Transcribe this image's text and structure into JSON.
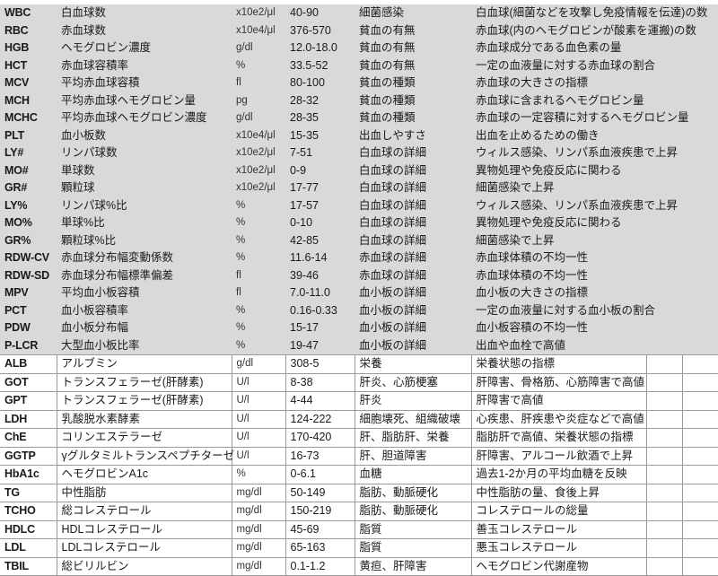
{
  "table": {
    "columns": [
      "code",
      "name",
      "unit",
      "range",
      "category",
      "description",
      "extra1",
      "extra2"
    ],
    "bands": {
      "hematology_bg": "#d9d9d9",
      "biochemistry_bg": "#ffffff",
      "grid_line": "#9a9a9a"
    },
    "rows": [
      {
        "code": "WBC",
        "name": "白血球数",
        "unit": "x10e2/μl",
        "range": "40-90",
        "category": "細菌感染",
        "description": "白血球(細菌などを攻撃し免疫情報を伝達)の数",
        "band": "grey"
      },
      {
        "code": "RBC",
        "name": "赤血球数",
        "unit": "x10e4/μl",
        "range": "376-570",
        "category": "貧血の有無",
        "description": "赤血球(内のヘモグロビンが酸素を運搬)の数",
        "band": "grey"
      },
      {
        "code": "HGB",
        "name": "ヘモグロビン濃度",
        "unit": "g/dl",
        "range": "12.0-18.0",
        "category": "貧血の有無",
        "description": "赤血球成分である血色素の量",
        "band": "grey"
      },
      {
        "code": "HCT",
        "name": "赤血球容積率",
        "unit": "%",
        "range": "33.5-52",
        "category": "貧血の有無",
        "description": "一定の血液量に対する赤血球の割合",
        "band": "grey"
      },
      {
        "code": "MCV",
        "name": "平均赤血球容積",
        "unit": "fl",
        "range": "80-100",
        "category": "貧血の種類",
        "description": "赤血球の大きさの指標",
        "band": "grey"
      },
      {
        "code": "MCH",
        "name": "平均赤血球ヘモグロビン量",
        "unit": "pg",
        "range": "28-32",
        "category": "貧血の種類",
        "description": "赤血球に含まれるヘモグロビン量",
        "band": "grey"
      },
      {
        "code": "MCHC",
        "name": "平均赤血球ヘモグロビン濃度",
        "unit": "g/dl",
        "range": "28-35",
        "category": "貧血の種類",
        "description": "赤血球の一定容積に対するヘモグロビン量",
        "band": "grey"
      },
      {
        "code": "PLT",
        "name": "血小板数",
        "unit": "x10e4/μl",
        "range": "15-35",
        "category": "出血しやすさ",
        "description": "出血を止めるための働き",
        "band": "grey"
      },
      {
        "code": "LY#",
        "name": "リンパ球数",
        "unit": "x10e2/μl",
        "range": "7-51",
        "category": "白血球の詳細",
        "description": "ウィルス感染、リンパ系血液疾患で上昇",
        "band": "grey"
      },
      {
        "code": "MO#",
        "name": "単球数",
        "unit": "x10e2/μl",
        "range": "0-9",
        "category": "白血球の詳細",
        "description": "異物処理や免疫反応に関わる",
        "band": "grey"
      },
      {
        "code": "GR#",
        "name": "顆粒球",
        "unit": "x10e2/μl",
        "range": "17-77",
        "category": "白血球の詳細",
        "description": "細菌感染で上昇",
        "band": "grey"
      },
      {
        "code": "LY%",
        "name": "リンパ球%比",
        "unit": "%",
        "range": "17-57",
        "category": "白血球の詳細",
        "description": "ウィルス感染、リンパ系血液疾患で上昇",
        "band": "grey"
      },
      {
        "code": "MO%",
        "name": "単球%比",
        "unit": "%",
        "range": "0-10",
        "category": "白血球の詳細",
        "description": "異物処理や免疫反応に関わる",
        "band": "grey"
      },
      {
        "code": "GR%",
        "name": "顆粒球%比",
        "unit": "%",
        "range": "42-85",
        "category": "白血球の詳細",
        "description": "細菌感染で上昇",
        "band": "grey"
      },
      {
        "code": "RDW-CV",
        "name": "赤血球分布幅変動係数",
        "unit": "%",
        "range": "11.6-14",
        "category": "赤血球の詳細",
        "description": "赤血球体積の不均一性",
        "band": "grey"
      },
      {
        "code": "RDW-SD",
        "name": "赤血球分布幅標準偏差",
        "unit": "fl",
        "range": "39-46",
        "category": "赤血球の詳細",
        "description": "赤血球体積の不均一性",
        "band": "grey"
      },
      {
        "code": "MPV",
        "name": "平均血小板容積",
        "unit": "fl",
        "range": "7.0-11.0",
        "category": "血小板の詳細",
        "description": "血小板の大きさの指標",
        "band": "grey"
      },
      {
        "code": "PCT",
        "name": "血小板容積率",
        "unit": "%",
        "range": "0.16-0.33",
        "category": "血小板の詳細",
        "description": "一定の血液量に対する血小板の割合",
        "band": "grey"
      },
      {
        "code": "PDW",
        "name": "血小板分布幅",
        "unit": "%",
        "range": "15-17",
        "category": "血小板の詳細",
        "description": "血小板容積の不均一性",
        "band": "grey"
      },
      {
        "code": "P-LCR",
        "name": "大型血小板比率",
        "unit": "%",
        "range": "19-47",
        "category": "血小板の詳細",
        "description": "出血や血栓で高値",
        "band": "grey"
      },
      {
        "code": "ALB",
        "name": "アルブミン",
        "unit": "g/dl",
        "range": "308-5",
        "category": "栄養",
        "description": "栄養状態の指標",
        "band": "white"
      },
      {
        "code": "GOT",
        "name": "トランスフェラーゼ(肝酵素)",
        "unit": "U/l",
        "range": "8-38",
        "category": "肝炎、心筋梗塞",
        "description": "肝障害、骨格筋、心筋障害で高値",
        "band": "white"
      },
      {
        "code": "GPT",
        "name": "トランスフェラーゼ(肝酵素)",
        "unit": "U/l",
        "range": "4-44",
        "category": "肝炎",
        "description": "肝障害で高値",
        "band": "white"
      },
      {
        "code": "LDH",
        "name": "乳酸脱水素酵素",
        "unit": "U/l",
        "range": "124-222",
        "category": "細胞壊死、組織破壊",
        "description": "心疾患、肝疾患や炎症などで高値",
        "band": "white"
      },
      {
        "code": "ChE",
        "name": "コリンエステラーゼ",
        "unit": "U/l",
        "range": "170-420",
        "category": "肝、脂肪肝、栄養",
        "description": "脂肪肝で高値、栄養状態の指標",
        "band": "white"
      },
      {
        "code": "GGTP",
        "name": "γグルタミルトランスペプチターゼ",
        "unit": "U/l",
        "range": "16-73",
        "category": "肝、胆道障害",
        "description": "肝障害、アルコール飲酒で上昇",
        "band": "white"
      },
      {
        "code": "HbA1c",
        "name": "ヘモグロビンA1c",
        "unit": "%",
        "range": "0-6.1",
        "category": "血糖",
        "description": "過去1-2か月の平均血糖を反映",
        "band": "white"
      },
      {
        "code": "TG",
        "name": "中性脂肪",
        "unit": "mg/dl",
        "range": "50-149",
        "category": "脂肪、動脈硬化",
        "description": "中性脂肪の量、食後上昇",
        "band": "white"
      },
      {
        "code": "TCHO",
        "name": "総コレステロール",
        "unit": "mg/dl",
        "range": "150-219",
        "category": "脂肪、動脈硬化",
        "description": "コレステロールの総量",
        "band": "white"
      },
      {
        "code": "HDLC",
        "name": "HDLコレステロール",
        "unit": "mg/dl",
        "range": "45-69",
        "category": "脂質",
        "description": "善玉コレステロール",
        "band": "white"
      },
      {
        "code": "LDL",
        "name": "LDLコレステロール",
        "unit": "mg/dl",
        "range": "65-163",
        "category": "脂質",
        "description": "悪玉コレステロール",
        "band": "white"
      },
      {
        "code": "TBIL",
        "name": "総ビリルビン",
        "unit": "mg/dl",
        "range": "0.1-1.2",
        "category": "黄疸、肝障害",
        "description": "ヘモグロビン代謝産物",
        "band": "white"
      }
    ]
  }
}
